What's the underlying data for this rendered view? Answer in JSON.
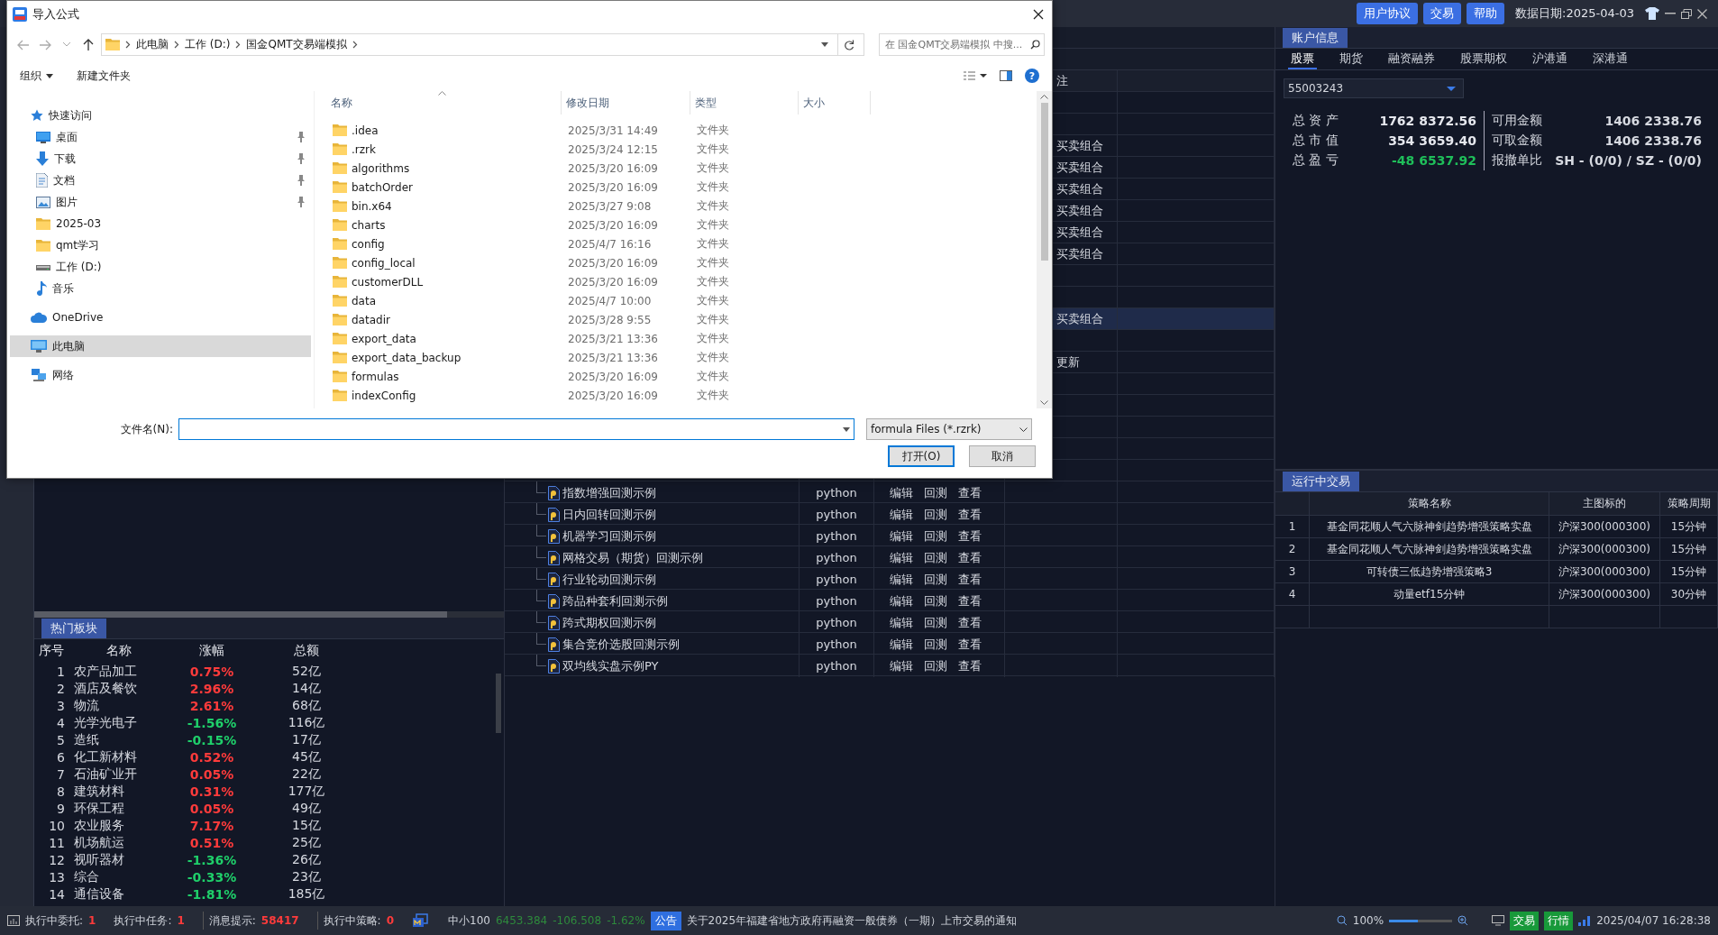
{
  "topbar": {
    "buttons": [
      "用户协议",
      "交易",
      "帮助"
    ],
    "data_date": "数据日期:2025-04-03"
  },
  "hot": {
    "tab": "热门板块",
    "columns": [
      "序号",
      "名称",
      "涨幅",
      "总额"
    ],
    "rows": [
      {
        "rank": "1",
        "name": "农产品加工",
        "change": "0.75%",
        "amount": "52亿",
        "color": "#ff3b3b"
      },
      {
        "rank": "2",
        "name": "酒店及餐饮",
        "change": "2.96%",
        "amount": "14亿",
        "color": "#ff3b3b"
      },
      {
        "rank": "3",
        "name": "物流",
        "change": "2.61%",
        "amount": "68亿",
        "color": "#ff3b3b"
      },
      {
        "rank": "4",
        "name": "光学光电子",
        "change": "-1.56%",
        "amount": "116亿",
        "color": "#1fcf6a"
      },
      {
        "rank": "5",
        "name": "造纸",
        "change": "-0.15%",
        "amount": "17亿",
        "color": "#1fcf6a"
      },
      {
        "rank": "6",
        "name": "化工新材料",
        "change": "0.52%",
        "amount": "45亿",
        "color": "#ff3b3b"
      },
      {
        "rank": "7",
        "name": "石油矿业开",
        "change": "0.05%",
        "amount": "22亿",
        "color": "#ff3b3b"
      },
      {
        "rank": "8",
        "name": "建筑材料",
        "change": "0.31%",
        "amount": "177亿",
        "color": "#ff3b3b"
      },
      {
        "rank": "9",
        "name": "环保工程",
        "change": "0.05%",
        "amount": "49亿",
        "color": "#ff3b3b"
      },
      {
        "rank": "10",
        "name": "农业服务",
        "change": "7.17%",
        "amount": "15亿",
        "color": "#ff3b3b"
      },
      {
        "rank": "11",
        "name": "机场航运",
        "change": "0.51%",
        "amount": "25亿",
        "color": "#ff3b3b"
      },
      {
        "rank": "12",
        "name": "视听器材",
        "change": "-1.36%",
        "amount": "26亿",
        "color": "#1fcf6a"
      },
      {
        "rank": "13",
        "name": "综合",
        "change": "-0.33%",
        "amount": "23亿",
        "color": "#1fcf6a"
      },
      {
        "rank": "14",
        "name": "通信设备",
        "change": "-1.81%",
        "amount": "185亿",
        "color": "#1fcf6a"
      }
    ]
  },
  "middle": {
    "header_note": "注",
    "rows": [
      {
        "selected": false
      },
      {
        "selected": false
      },
      {
        "note": "买卖组合",
        "selected": false
      },
      {
        "note": "买卖组合",
        "selected": false
      },
      {
        "note": "买卖组合",
        "selected": false
      },
      {
        "note": "买卖组合",
        "selected": false
      },
      {
        "note": "买卖组合",
        "selected": false
      },
      {
        "note": "买卖组合",
        "selected": false
      },
      {
        "selected": false
      },
      {
        "selected": false
      },
      {
        "note": "买卖组合",
        "selected": true
      },
      {
        "selected": false
      },
      {
        "note": "更新",
        "selected": false
      },
      {
        "selected": false
      },
      {
        "selected": false
      },
      {
        "selected": false
      },
      {
        "selected": false
      },
      {
        "selected": false
      },
      {
        "name": "指数增强回测示例",
        "type": "python",
        "actions": [
          "编辑",
          "回测",
          "查看"
        ],
        "selected": false
      },
      {
        "name": "日内回转回测示例",
        "type": "python",
        "actions": [
          "编辑",
          "回测",
          "查看"
        ],
        "selected": false
      },
      {
        "name": "机器学习回测示例",
        "type": "python",
        "actions": [
          "编辑",
          "回测",
          "查看"
        ],
        "selected": false
      },
      {
        "name": "网格交易（期货）回测示例",
        "type": "python",
        "actions": [
          "编辑",
          "回测",
          "查看"
        ],
        "selected": false
      },
      {
        "name": "行业轮动回测示例",
        "type": "python",
        "actions": [
          "编辑",
          "回测",
          "查看"
        ],
        "selected": false
      },
      {
        "name": "跨品种套利回测示例",
        "type": "python",
        "actions": [
          "编辑",
          "回测",
          "查看"
        ],
        "selected": false
      },
      {
        "name": "跨式期权回测示例",
        "type": "python",
        "actions": [
          "编辑",
          "回测",
          "查看"
        ],
        "selected": false
      },
      {
        "name": "集合竞价选股回测示例",
        "type": "python",
        "actions": [
          "编辑",
          "回测",
          "查看"
        ],
        "selected": false
      },
      {
        "name": "双均线实盘示例PY",
        "type": "python",
        "actions": [
          "编辑",
          "回测",
          "查看"
        ],
        "selected": false
      }
    ]
  },
  "account": {
    "tab": "账户信息",
    "subtabs": [
      {
        "label": "股票",
        "selected": true
      },
      {
        "label": "期货",
        "selected": false
      },
      {
        "label": "融资融券",
        "selected": false
      },
      {
        "label": "股票期权",
        "selected": false
      },
      {
        "label": "沪港通",
        "selected": false
      },
      {
        "label": "深港通",
        "selected": false
      }
    ],
    "account_id": "55003243",
    "stats": [
      {
        "label": "总 资 产",
        "value": "1762 8372.56",
        "color": "#e6e8ee",
        "label2": "可用金额",
        "value2": "1406 2338.76"
      },
      {
        "label": "总 市 值",
        "value": "354 3659.40",
        "color": "#e6e8ee",
        "label2": "可取金额",
        "value2": "1406 2338.76"
      },
      {
        "label": "总 盈 亏",
        "value": "-48 6537.92",
        "color": "#1fbf5a",
        "label2": "报撤单比",
        "value2": "SH - (0/0) / SZ - (0/0)"
      }
    ]
  },
  "running": {
    "tab": "运行中交易",
    "columns": [
      "策略名称",
      "主图标的",
      "策略周期"
    ],
    "rows": [
      {
        "index": "1",
        "name": "基金同花顺人气六脉神剑趋势增强策略实盘",
        "symbol": "沪深300(000300)",
        "period": "15分钟"
      },
      {
        "index": "2",
        "name": "基金同花顺人气六脉神剑趋势增强策略实盘",
        "symbol": "沪深300(000300)",
        "period": "15分钟"
      },
      {
        "index": "3",
        "name": "可转债三低趋势增强策略3",
        "symbol": "沪深300(000300)",
        "period": "15分钟"
      },
      {
        "index": "4",
        "name": "动量etf15分钟",
        "symbol": "沪深300(000300)",
        "period": "30分钟"
      }
    ]
  },
  "status": {
    "items": [
      {
        "label": "执行中委托:",
        "value": "1"
      },
      {
        "label": "执行中任务:",
        "value": "1"
      },
      {
        "label": "消息提示:",
        "value": "58417"
      },
      {
        "label": "执行中策略:",
        "value": "0"
      }
    ],
    "index": {
      "name": "中小100",
      "price": "6453.384",
      "change": "-106.508",
      "percent": "-1.62%"
    },
    "notice_badge": "公告",
    "notice": "关于2025年福建省地方政府再融资一般债券（一期）上市交易的通知",
    "zoom": {
      "reading": "100%",
      "level": 0.45
    },
    "badges": [
      "交易",
      "行情"
    ],
    "datetime": "2025/04/07 16:28:38"
  },
  "dialog": {
    "title": "导入公式",
    "breadcrumb": [
      "此电脑",
      "工作 (D:)",
      "国金QMT交易端模拟"
    ],
    "search": {
      "placeholder": "在 国金QMT交易端模拟 中搜..."
    },
    "toolbar": [
      "组织",
      "新建文件夹"
    ],
    "help": "?",
    "nav": [
      {
        "label": "快速访问",
        "kind": "star",
        "selected": false,
        "children": [
          {
            "label": "桌面",
            "kind": "desktop",
            "pinned": true,
            "selected": false
          },
          {
            "label": "下载",
            "kind": "download",
            "pinned": true,
            "selected": false
          },
          {
            "label": "文档",
            "kind": "document",
            "pinned": true,
            "selected": false
          },
          {
            "label": "图片",
            "kind": "picture",
            "pinned": true,
            "selected": false
          },
          {
            "label": "2025-03",
            "kind": "folder",
            "pinned": false,
            "selected": false
          },
          {
            "label": "qmt学习",
            "kind": "folder",
            "pinned": false,
            "selected": false
          },
          {
            "label": "工作 (D:)",
            "kind": "drive",
            "pinned": false,
            "selected": false
          },
          {
            "label": "音乐",
            "kind": "music",
            "pinned": false,
            "selected": false
          }
        ]
      },
      {
        "label": "OneDrive",
        "kind": "cloud",
        "selected": false
      },
      {
        "label": "此电脑",
        "kind": "computer",
        "selected": true
      },
      {
        "label": "网络",
        "kind": "network",
        "selected": false
      }
    ],
    "columns": [
      {
        "label": "名称",
        "sorted": true
      },
      {
        "label": "修改日期",
        "sorted": false
      },
      {
        "label": "类型",
        "sorted": false
      },
      {
        "label": "大小",
        "sorted": false
      }
    ],
    "files": [
      {
        "name": ".idea",
        "modified": "2025/3/31 14:49",
        "type": "文件夹"
      },
      {
        "name": ".rzrk",
        "modified": "2025/3/24 12:15",
        "type": "文件夹"
      },
      {
        "name": "algorithms",
        "modified": "2025/3/20 16:09",
        "type": "文件夹"
      },
      {
        "name": "batchOrder",
        "modified": "2025/3/20 16:09",
        "type": "文件夹"
      },
      {
        "name": "bin.x64",
        "modified": "2025/3/27 9:08",
        "type": "文件夹"
      },
      {
        "name": "charts",
        "modified": "2025/3/20 16:09",
        "type": "文件夹"
      },
      {
        "name": "config",
        "modified": "2025/4/7 16:16",
        "type": "文件夹"
      },
      {
        "name": "config_local",
        "modified": "2025/3/20 16:09",
        "type": "文件夹"
      },
      {
        "name": "customerDLL",
        "modified": "2025/3/20 16:09",
        "type": "文件夹"
      },
      {
        "name": "data",
        "modified": "2025/4/7 10:00",
        "type": "文件夹"
      },
      {
        "name": "datadir",
        "modified": "2025/3/28 9:55",
        "type": "文件夹"
      },
      {
        "name": "export_data",
        "modified": "2025/3/21 13:36",
        "type": "文件夹"
      },
      {
        "name": "export_data_backup",
        "modified": "2025/3/21 13:36",
        "type": "文件夹"
      },
      {
        "name": "formulas",
        "modified": "2025/3/20 16:09",
        "type": "文件夹"
      },
      {
        "name": "indexConfig",
        "modified": "2025/3/20 16:09",
        "type": "文件夹"
      }
    ],
    "filename_label": "文件名(N):",
    "filter": "formula Files (*.rzrk)",
    "buttons": [
      {
        "label": "打开(O)",
        "default": true
      },
      {
        "label": "取消",
        "default": false
      }
    ]
  }
}
